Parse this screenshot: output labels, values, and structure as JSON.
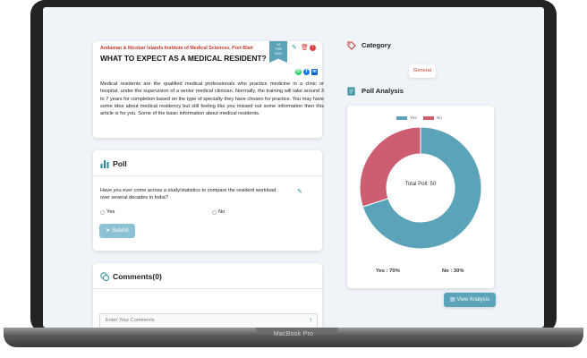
{
  "article": {
    "institute": "Andaman & Nicobar Islands Institute of Medical Sciences, Port Blair",
    "title": "WHAT TO EXPECT AS A MEDICAL RESIDENT?",
    "date_badge": [
      "14",
      "FEB",
      "2024"
    ],
    "body": "Medical residents are the qualified medical professionals who practice medicine in a clinic or hospital, under the supervision of a senior medical clinician. Normally, the training will take around 3 to 7 years for completion based on the type of specialty they have chosen for practice. You may have some idea about medical residency but still feeling like you missed out some information then this article is for you. Some of the basic information about medical residents.",
    "actions": [
      "edit-icon",
      "delete-icon",
      "report-icon"
    ],
    "share_icons": [
      "whatsapp-icon",
      "facebook-icon",
      "linkedin-icon"
    ],
    "colors": {
      "institute": "#c0392b",
      "date_badge": "#5ba3b8",
      "whatsapp": "#25d366",
      "facebook": "#1877f2",
      "linkedin": "#0a66c2"
    }
  },
  "poll": {
    "title": "Poll",
    "question": "Have you ever come across a study/statistics to compare the resident workload over several decades in India?",
    "options": [
      "Yes",
      "No"
    ],
    "submit_label": "Submit"
  },
  "comments": {
    "title": "Comments(0)",
    "placeholder": "Enter Your Comments"
  },
  "category": {
    "title": "Category",
    "tag": "General"
  },
  "poll_analysis": {
    "title": "Poll Analysis",
    "center_label": "Total Poll: 50",
    "yes_stat": "Yes : 70%",
    "no_stat": "No : 30%",
    "view_button": "View Analysis"
  },
  "chart_data": {
    "type": "pie",
    "categories": [
      "Yes",
      "No"
    ],
    "values": [
      70,
      30
    ],
    "colors": [
      "#5ba3b8",
      "#cd5d70"
    ],
    "legend_position": "top"
  },
  "device": {
    "label": "MacBook Pro"
  }
}
